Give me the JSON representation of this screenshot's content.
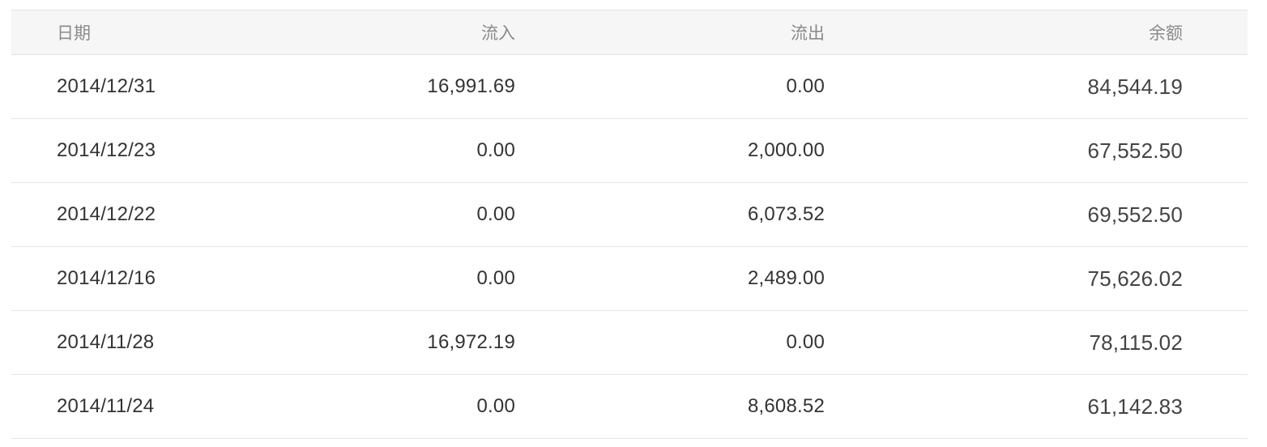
{
  "table": {
    "headers": {
      "date": "日期",
      "inflow": "流入",
      "outflow": "流出",
      "balance": "余额"
    },
    "rows": [
      {
        "date": "2014/12/31",
        "inflow": "16,991.69",
        "outflow": "0.00",
        "balance": "84,544.19"
      },
      {
        "date": "2014/12/23",
        "inflow": "0.00",
        "outflow": "2,000.00",
        "balance": "67,552.50"
      },
      {
        "date": "2014/12/22",
        "inflow": "0.00",
        "outflow": "6,073.52",
        "balance": "69,552.50"
      },
      {
        "date": "2014/12/16",
        "inflow": "0.00",
        "outflow": "2,489.00",
        "balance": "75,626.02"
      },
      {
        "date": "2014/11/28",
        "inflow": "16,972.19",
        "outflow": "0.00",
        "balance": "78,115.02"
      },
      {
        "date": "2014/11/24",
        "inflow": "0.00",
        "outflow": "8,608.52",
        "balance": "61,142.83"
      }
    ]
  }
}
